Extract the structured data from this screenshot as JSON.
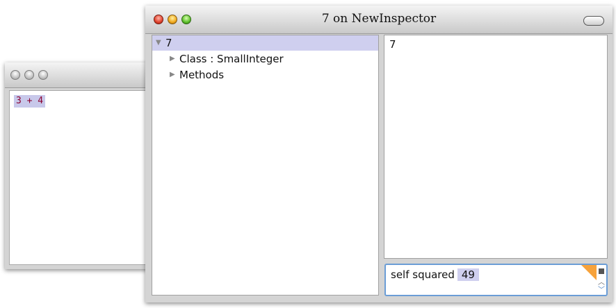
{
  "workspace_window": {
    "code": "3 + 4"
  },
  "inspector_window": {
    "title": "7 on NewInspector",
    "tree": [
      {
        "label": "7",
        "expanded": true,
        "selected": true,
        "indent": 0
      },
      {
        "label": "Class : SmallInteger",
        "expanded": false,
        "selected": false,
        "indent": 1
      },
      {
        "label": "Methods",
        "expanded": false,
        "selected": false,
        "indent": 1
      }
    ],
    "value_text": "7",
    "eval_input": "self squared",
    "eval_result": "49"
  },
  "colors": {
    "selection": "#cfcfef",
    "code_text": "#8b0030",
    "focus_ring": "#6b9dd6",
    "corner_accent": "#f7a23a"
  },
  "icons": {
    "expanded": "▼",
    "collapsed": "▶",
    "scroll_up": "︿",
    "scroll_down": "﹀"
  }
}
